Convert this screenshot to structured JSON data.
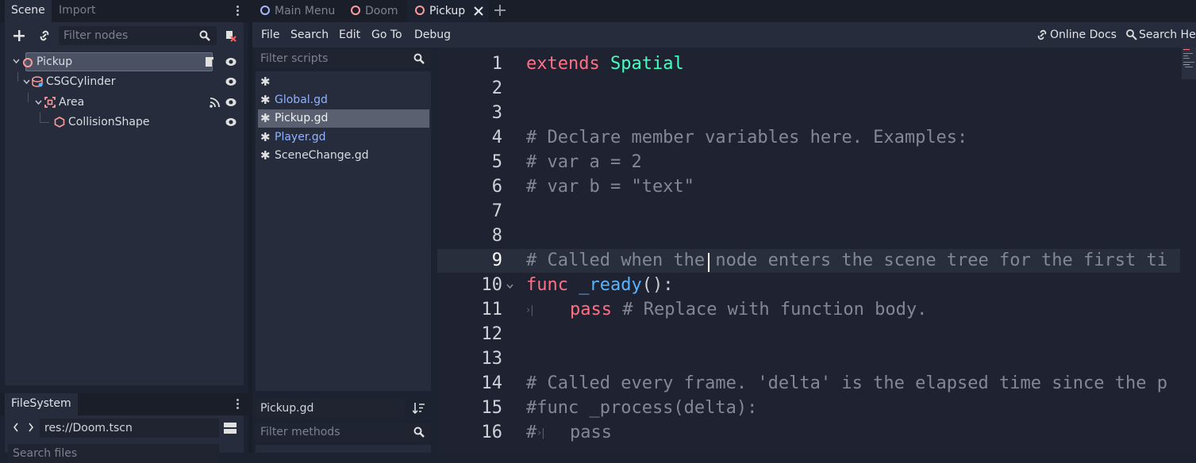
{
  "left_dock": {
    "tabs": [
      "Scene",
      "Import"
    ],
    "filter_placeholder": "Filter nodes",
    "tree": [
      {
        "label": "Pickup"
      },
      {
        "label": "CSGCylinder"
      },
      {
        "label": "Area"
      },
      {
        "label": "CollisionShape"
      }
    ]
  },
  "filesystem": {
    "tab": "FileSystem",
    "path": "res://Doom.tscn",
    "search_placeholder": "Search files"
  },
  "doc_tabs": [
    {
      "label": "Main Menu",
      "color": "#a9b7ff"
    },
    {
      "label": "Doom",
      "color": "#fc9c9c"
    },
    {
      "label": "Pickup",
      "color": "#fc9c9c"
    }
  ],
  "menu": {
    "items": [
      "File",
      "Search",
      "Edit",
      "Go To",
      "Debug"
    ],
    "online_docs": "Online Docs",
    "search_help": "Search Help"
  },
  "scripts": {
    "filter_placeholder": "Filter scripts",
    "items": [
      "Global.gd",
      "Pickup.gd",
      "Player.gd",
      "SceneChange.gd"
    ],
    "current": "Pickup.gd",
    "methods_placeholder": "Filter methods"
  },
  "code_lines": [
    "1",
    "2",
    "3",
    "4",
    "5",
    "6",
    "7",
    "8",
    "9",
    "10",
    "11",
    "12",
    "13",
    "14",
    "15",
    "16"
  ],
  "code": {
    "l1a": "extends",
    "l1b": "Spatial",
    "l4": "# Declare member variables here. Examples:",
    "l5": "# var a = 2",
    "l6": "# var b = \"text\"",
    "l9": "# Called when the node enters the scene tree for the first ti",
    "l10a": "func",
    "l10b": "_ready",
    "l10c": "():",
    "l11a": "pass",
    "l11b": "# Replace with function body.",
    "l14": "# Called every frame. 'delta' is the elapsed time since the p",
    "l15": "#func _process(delta):",
    "l16a": "#",
    "l16b": "pass"
  }
}
